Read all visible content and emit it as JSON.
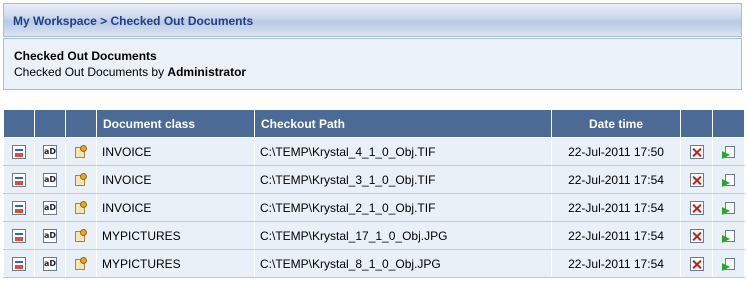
{
  "breadcrumb": "My Workspace > Checked Out Documents",
  "info": {
    "title": "Checked Out Documents",
    "subtitle_prefix": "Checked Out Documents by ",
    "user": "Administrator"
  },
  "table": {
    "headers": [
      "",
      "",
      "",
      "Document class",
      "Checkout Path",
      "Date time",
      "",
      ""
    ],
    "row_icons": [
      "view-document-icon",
      "annotate-icon",
      "properties-icon",
      "cancel-checkout-icon",
      "check-in-icon"
    ],
    "rows": [
      {
        "doc_class": "INVOICE",
        "path": "C:\\TEMP\\Krystal_4_1_0_Obj.TIF",
        "datetime": "22-Jul-2011 17:50"
      },
      {
        "doc_class": "INVOICE",
        "path": "C:\\TEMP\\Krystal_3_1_0_Obj.TIF",
        "datetime": "22-Jul-2011 17:54"
      },
      {
        "doc_class": "INVOICE",
        "path": "C:\\TEMP\\Krystal_2_1_0_Obj.TIF",
        "datetime": "22-Jul-2011 17:54"
      },
      {
        "doc_class": "MYPICTURES",
        "path": "C:\\TEMP\\Krystal_17_1_0_Obj.JPG",
        "datetime": "22-Jul-2011 17:54"
      },
      {
        "doc_class": "MYPICTURES",
        "path": "C:\\TEMP\\Krystal_8_1_0_Obj.JPG",
        "datetime": "22-Jul-2011 17:54"
      }
    ],
    "annotate_glyph": "aD"
  },
  "colors": {
    "header_bg": "#4c6a96",
    "row_bg": "#e9f0f8",
    "breadcrumb_text": "#1f3f86"
  }
}
